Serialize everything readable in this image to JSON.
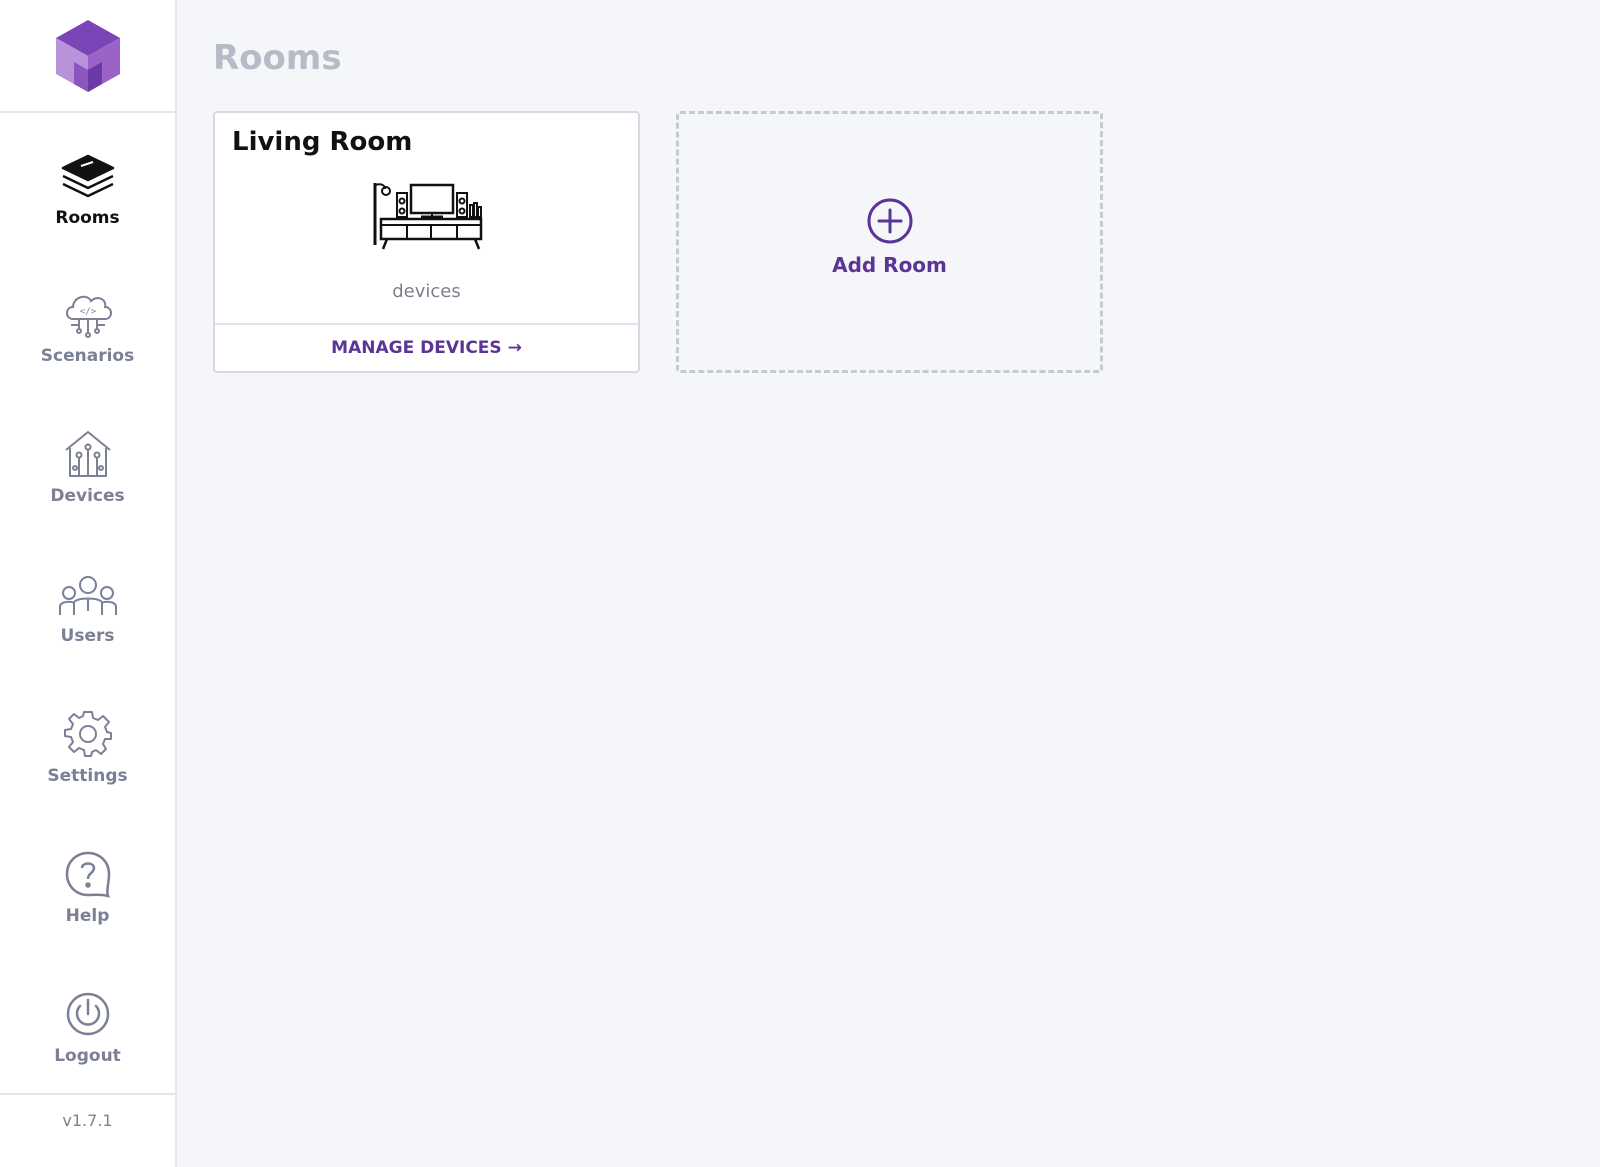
{
  "sidebar": {
    "logo_icon": "cube-logo",
    "items": [
      {
        "label": "Rooms",
        "icon": "layers-icon",
        "active": true
      },
      {
        "label": "Scenarios",
        "icon": "cloud-code-icon"
      },
      {
        "label": "Devices",
        "icon": "smart-home-icon"
      },
      {
        "label": "Users",
        "icon": "users-group-icon"
      },
      {
        "label": "Settings",
        "icon": "gear-icon"
      },
      {
        "label": "Help",
        "icon": "help-chat-icon"
      },
      {
        "label": "Logout",
        "icon": "power-icon"
      }
    ],
    "version": "v1.7.1"
  },
  "main": {
    "title": "Rooms",
    "rooms": [
      {
        "name": "Living Room",
        "illustration": "living-room-tv-icon",
        "devices_text": "devices",
        "manage_label": "MANAGE DEVICES →"
      }
    ],
    "add_room": {
      "label": "Add Room",
      "icon": "plus-circle-icon"
    }
  },
  "colors": {
    "accent": "#5a3596",
    "background": "#f5f6fa",
    "nav_inactive": "#7c8096",
    "title_muted": "#b7bbc8"
  }
}
